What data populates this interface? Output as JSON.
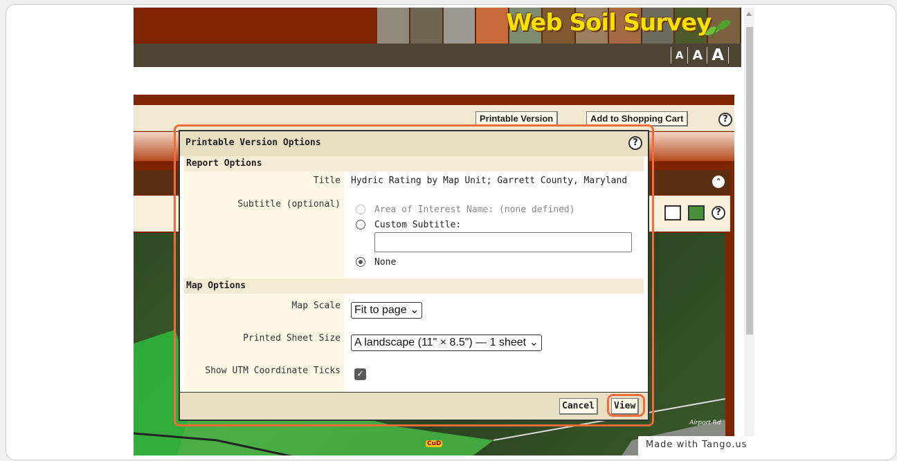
{
  "header": {
    "banner_title": "Web Soil Survey",
    "font_sizes": [
      "A",
      "A",
      "A"
    ],
    "tile_colors": [
      "#8f8a7a",
      "#6c6653",
      "#9a9a92",
      "#c86b3b",
      "#7d8c70",
      "#7f5a30",
      "#9b7d5f",
      "#a46a43",
      "#6d6b60",
      "#4e5a2c",
      "#7b6140"
    ]
  },
  "toolbar": {
    "printable_version": "Printable Version",
    "add_to_cart": "Add to Shopping Cart",
    "help": "?"
  },
  "dialog": {
    "title": "Printable Version Options",
    "help": "?",
    "report_options": {
      "heading": "Report Options",
      "title_label": "Title",
      "title_value": "Hydric Rating by Map Unit; Garrett County, Maryland",
      "subtitle_label": "Subtitle (optional)",
      "aoi_option": "Area of Interest Name:",
      "aoi_value": "(none defined)",
      "custom_option": "Custom Subtitle:",
      "custom_value": "",
      "none_option": "None",
      "selected": "None"
    },
    "map_options": {
      "heading": "Map Options",
      "scale_label": "Map Scale",
      "scale_value": "Fit to page",
      "sheet_label": "Printed Sheet Size",
      "sheet_value": "A landscape (11\" × 8.5\") — 1 sheet",
      "utm_label": "Show UTM Coordinate Ticks",
      "utm_checked": true
    },
    "cancel": "Cancel",
    "view": "View"
  },
  "map": {
    "road_label": "Airport Rd",
    "unit_label": "CuD"
  },
  "watermark": "Made with Tango.us",
  "colors": {
    "header_red": "#7f2400",
    "header_bar": "#4d4433",
    "highlight": "#f26b38",
    "banner_text": "#f8e000"
  }
}
